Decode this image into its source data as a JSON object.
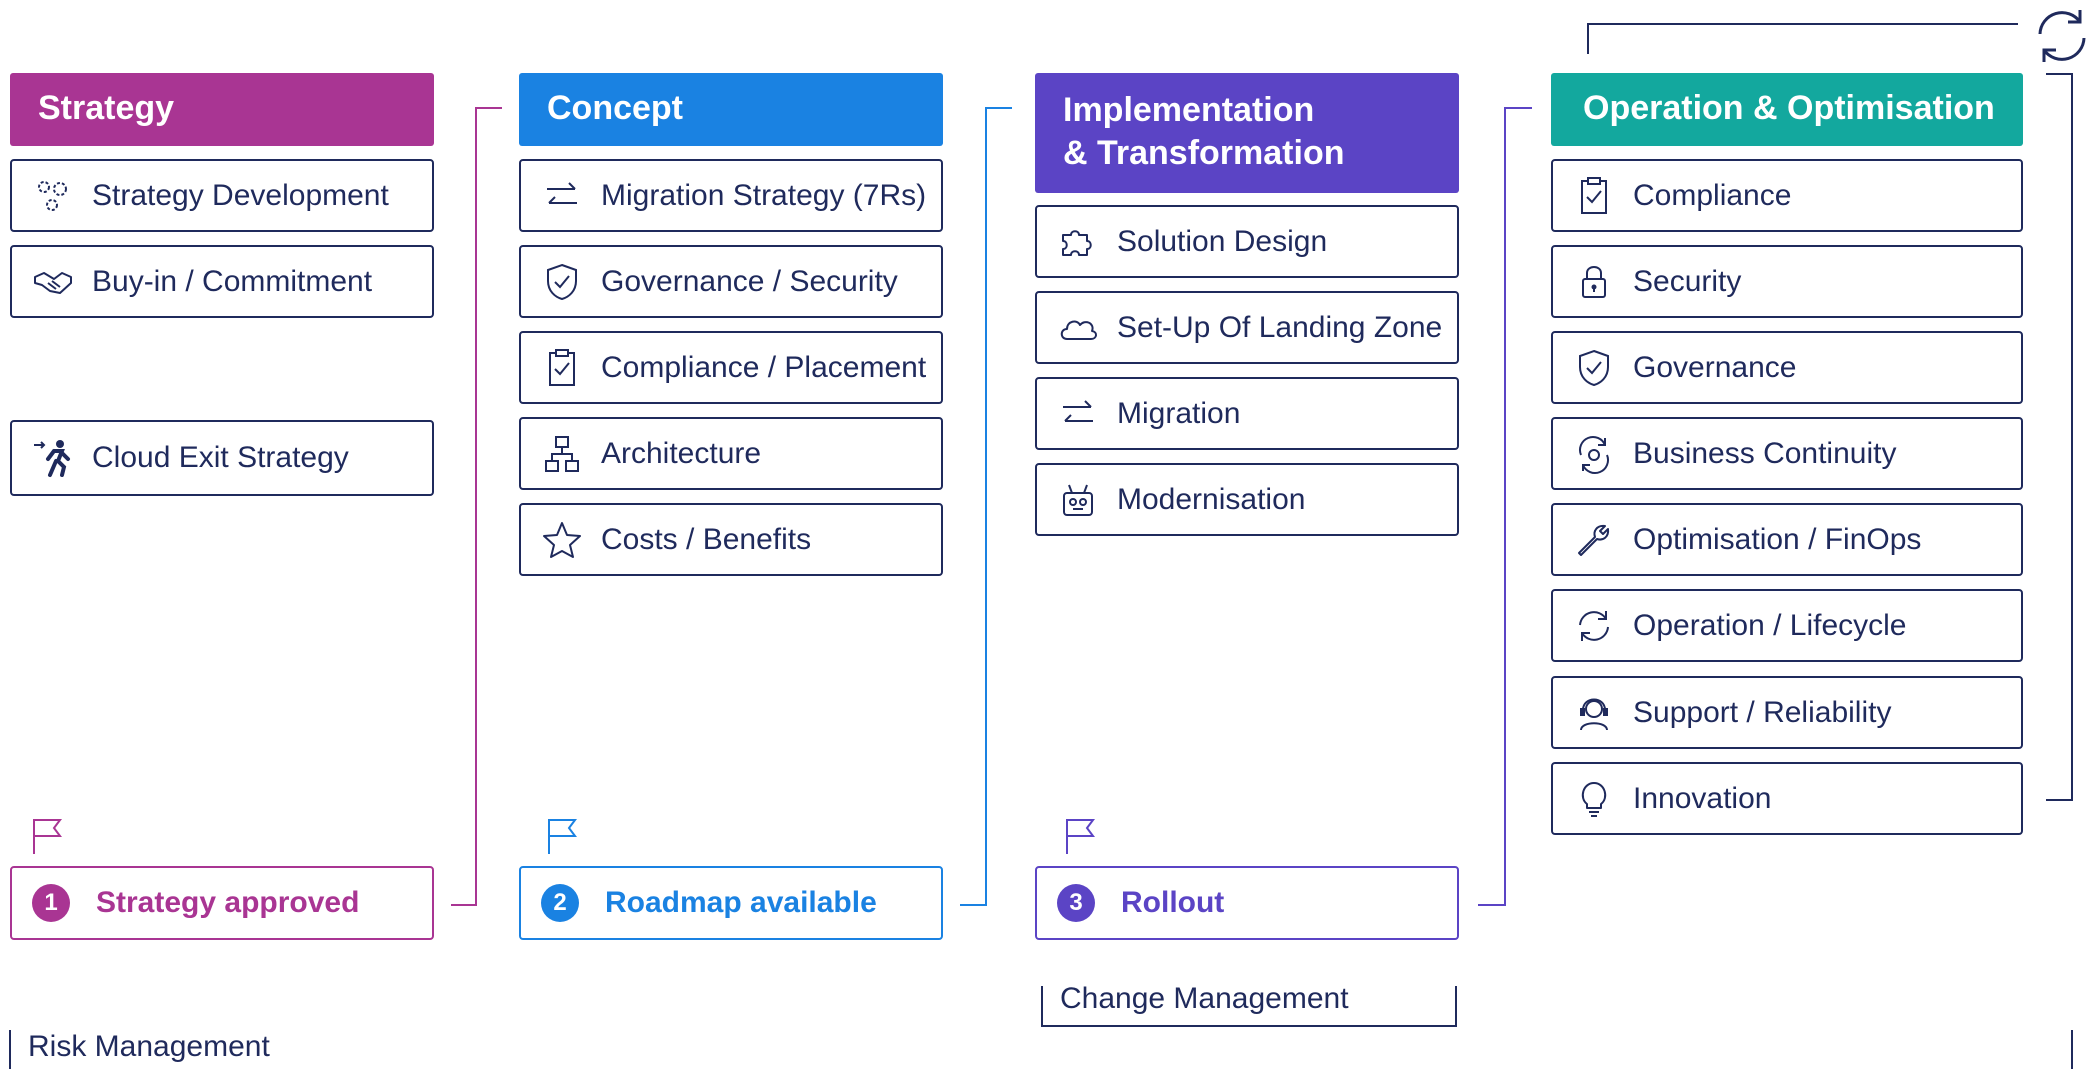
{
  "colors": {
    "strategy": "#a93593",
    "concept": "#1a82e2",
    "implementation": "#5b44c5",
    "operation": "#13a89e",
    "border": "#1f2a5c"
  },
  "columns": {
    "strategy": {
      "title": "Strategy",
      "items": [
        {
          "label": "Strategy Development",
          "icon": "gears-icon"
        },
        {
          "label": "Buy-in / Commitment",
          "icon": "handshake-icon"
        },
        {
          "label": "Cloud Exit Strategy",
          "icon": "running-exit-icon"
        }
      ],
      "milestone": {
        "number": "1",
        "label": "Strategy approved"
      }
    },
    "concept": {
      "title": "Concept",
      "items": [
        {
          "label": "Migration Strategy (7Rs)",
          "icon": "arrows-exchange-icon"
        },
        {
          "label": "Governance / Security",
          "icon": "shield-check-icon"
        },
        {
          "label": "Compliance / Placement",
          "icon": "clipboard-check-icon"
        },
        {
          "label": "Architecture",
          "icon": "hierarchy-icon"
        },
        {
          "label": "Costs / Benefits",
          "icon": "star-icon"
        }
      ],
      "milestone": {
        "number": "2",
        "label": "Roadmap available"
      }
    },
    "implementation": {
      "title_line1": "Implementation",
      "title_line2": "& Transformation",
      "items": [
        {
          "label": "Solution Design",
          "icon": "puzzle-icon"
        },
        {
          "label": "Set-Up Of Landing Zone",
          "icon": "cloud-icon"
        },
        {
          "label": "Migration",
          "icon": "arrows-exchange-icon"
        },
        {
          "label": "Modernisation",
          "icon": "robot-icon"
        }
      ],
      "milestone": {
        "number": "3",
        "label": "Rollout"
      }
    },
    "operation": {
      "title": "Operation & Optimisation",
      "items": [
        {
          "label": "Compliance",
          "icon": "clipboard-check-icon"
        },
        {
          "label": "Security",
          "icon": "lock-icon"
        },
        {
          "label": "Governance",
          "icon": "shield-check-icon"
        },
        {
          "label": "Business Continuity",
          "icon": "continuity-icon"
        },
        {
          "label": "Optimisation / FinOps",
          "icon": "wrench-icon"
        },
        {
          "label": "Operation / Lifecycle",
          "icon": "refresh-icon"
        },
        {
          "label": "Support / Reliability",
          "icon": "headset-icon"
        },
        {
          "label": "Innovation",
          "icon": "lightbulb-icon"
        }
      ]
    }
  },
  "change_management": "Change Management",
  "risk_management": "Risk Management"
}
